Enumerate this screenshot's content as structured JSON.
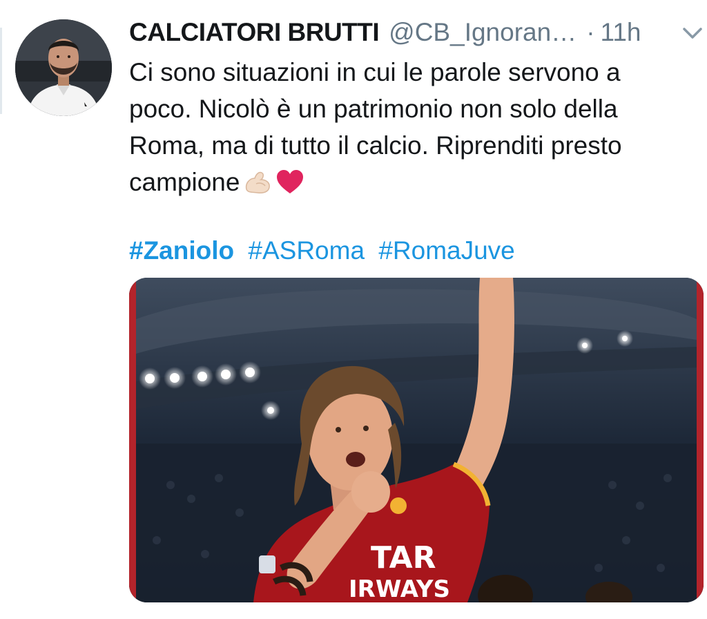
{
  "tweet": {
    "author": {
      "display_name": "CALCIATORI BRUTTI",
      "handle": "@CB_Ignoran…",
      "avatar_icon": "profile-photo"
    },
    "separator": "·",
    "timestamp": "11h",
    "menu_icon": "chevron-down-icon",
    "body_lines": [
      "Ci sono situazioni in cui le parole servono a",
      "poco. Nicolò è un patrimonio non solo della",
      "Roma, ma di tutto il calcio. Riprenditi presto",
      "campione"
    ],
    "emojis": [
      "flexed-biceps-icon",
      "red-heart-icon"
    ],
    "hashtags": [
      "#Zaniolo",
      "#ASRoma",
      "#RomaJuve"
    ],
    "media": {
      "jersey_text_line1": "TAR",
      "jersey_text_line2": "IRWAYS"
    }
  },
  "colors": {
    "text": "#14171a",
    "muted": "#657786",
    "link": "#1b95e0",
    "heart": "#e0245e",
    "jersey": "#a8161c"
  }
}
